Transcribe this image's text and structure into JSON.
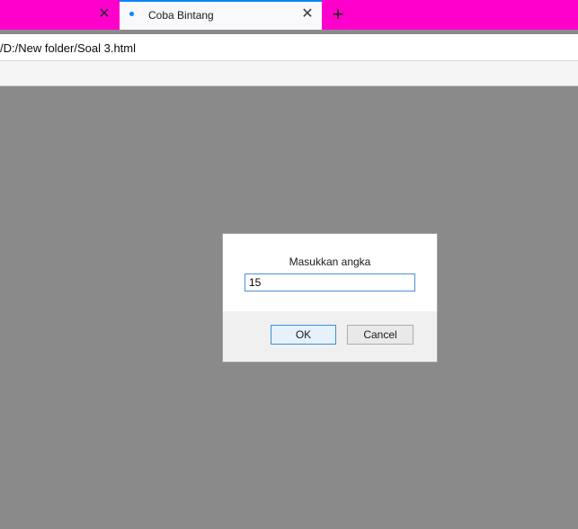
{
  "tabs": {
    "active_title": "Coba Bintang",
    "close_glyph": "✕",
    "new_tab_glyph": "+"
  },
  "address_bar": {
    "url": "/D:/New folder/Soal 3.html"
  },
  "dialog": {
    "message": "Masukkan angka",
    "input_value": "15",
    "ok_label": "OK",
    "cancel_label": "Cancel"
  },
  "colors": {
    "tabbar": "#ff00cc",
    "accent": "#0a84ff",
    "overlay": "#8a8a8a"
  }
}
